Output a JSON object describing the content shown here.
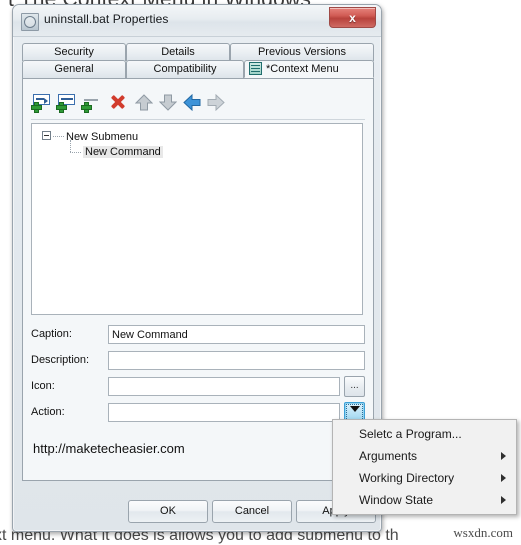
{
  "background": {
    "heading_partial": "t The Context Menu in Windows",
    "body_partial": "xt menu. What it does is allows you to add submenu to th",
    "watermark": "wsxdn.com"
  },
  "window": {
    "title": "uninstall.bat Properties",
    "title_icon": "file-properties-icon",
    "close_label": "x"
  },
  "tabs": {
    "row1": [
      {
        "label": "Security",
        "name": "tab-security"
      },
      {
        "label": "Details",
        "name": "tab-details"
      },
      {
        "label": "Previous Versions",
        "name": "tab-previous-versions"
      }
    ],
    "row2": [
      {
        "label": "General",
        "name": "tab-general"
      },
      {
        "label": "Compatibility",
        "name": "tab-compatibility"
      },
      {
        "label": "*Context Menu",
        "name": "tab-context-menu",
        "icon": "context-menu-icon",
        "active": true
      }
    ]
  },
  "toolbar": {
    "buttons": [
      {
        "name": "add-submenu-button",
        "icon": "add-submenu-icon",
        "title": "Add Submenu"
      },
      {
        "name": "add-command-button",
        "icon": "add-command-icon",
        "title": "Add Command"
      },
      {
        "name": "add-separator-button",
        "icon": "add-separator-icon",
        "title": "Add Separator"
      },
      {
        "name": "delete-button",
        "icon": "delete-x-icon",
        "title": "Delete"
      },
      {
        "name": "move-up-button",
        "icon": "arrow-up-icon",
        "title": "Move Up"
      },
      {
        "name": "move-down-button",
        "icon": "arrow-down-icon",
        "title": "Move Down"
      },
      {
        "name": "move-left-button",
        "icon": "arrow-left-icon",
        "title": "Move Left"
      },
      {
        "name": "move-right-button",
        "icon": "arrow-right-icon",
        "title": "Move Right"
      }
    ]
  },
  "tree": {
    "root_label": "New Submenu",
    "child_label": "New Command"
  },
  "form": {
    "caption": {
      "label": "Caption:",
      "value": "New Command"
    },
    "description": {
      "label": "Description:",
      "value": ""
    },
    "icon": {
      "label": "Icon:",
      "value": "",
      "browse_label": "..."
    },
    "action": {
      "label": "Action:",
      "value": "",
      "dropdown_icon": "chevron-down-icon"
    }
  },
  "inner_url": "http://maketecheasier.com",
  "buttons": {
    "ok": "OK",
    "cancel": "Cancel",
    "apply": "Apply"
  },
  "popup_menu": {
    "items": [
      {
        "label": "Seletc a Program...",
        "submenu": false,
        "name": "menu-item-select-a-program"
      },
      {
        "label": "Arguments",
        "submenu": true,
        "name": "menu-item-arguments"
      },
      {
        "label": "Working Directory",
        "submenu": true,
        "name": "menu-item-working-directory"
      },
      {
        "label": "Window State",
        "submenu": true,
        "name": "menu-item-window-state"
      }
    ]
  },
  "colors": {
    "accent_blue": "#3c9fd6",
    "close_red": "#c0504a",
    "delete_red": "#d13c2d",
    "add_green": "#2f9a36",
    "dialog_bg": "#e9eef2"
  }
}
